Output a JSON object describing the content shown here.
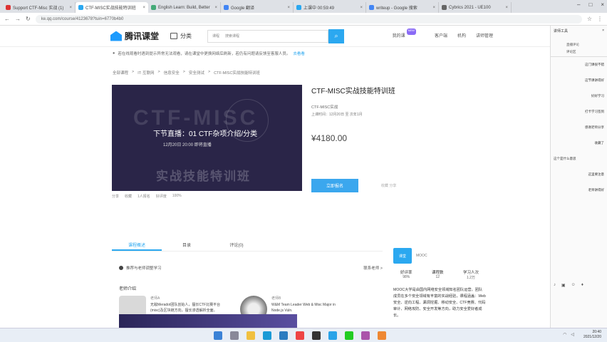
{
  "browser": {
    "tabs": [
      {
        "label": "Support CTF-Misc 实战 (1)",
        "color": "#d33"
      },
      {
        "label": "CTF-MISC实战技能特训班",
        "color": "#2ba8f0"
      },
      {
        "label": "English Learn: Build, Better",
        "color": "#4a7"
      },
      {
        "label": "Google 翻译",
        "color": "#4285f4"
      },
      {
        "label": "上课中 00:59:49",
        "color": "#2ba8f0"
      },
      {
        "label": "writeup - Google 搜索",
        "color": "#4285f4"
      },
      {
        "label": "Cybrics 2021 - UE100",
        "color": "#666"
      }
    ],
    "url": "ke.qq.com/course/4123678?tuin=6770b4b0",
    "window_controls": [
      "–",
      "□",
      "×"
    ]
  },
  "header": {
    "logo_text": "腾讯课堂",
    "category_label": "分类",
    "search_scope": "课程",
    "search_placeholder": "搜索课程",
    "search_icon": "search-icon",
    "right_links": [
      "我的课",
      "客户端",
      "机构",
      "讲师管理"
    ],
    "badge": "NEW"
  },
  "notice": {
    "text": "若在线观看时遇到提示异常无法观看，请在课堂中更换网络后刷新，若仍有问题请反馈至客服人员。",
    "link": "去看看"
  },
  "breadcrumb": [
    "全部课程",
    ">",
    "IT·互联网",
    ">",
    "信息安全",
    ">",
    "安全测试",
    ">",
    "CTF-MISC实战技能特训班"
  ],
  "video": {
    "title": "下节直播：01 CTF杂项介绍/分类",
    "date": "12月20日 20:00    即将直播",
    "bg_text": "CTF-MISC",
    "sub_text": "实战技能特训班"
  },
  "stats": [
    "分享",
    "收藏",
    "1人报名",
    "好评度",
    "100%"
  ],
  "course": {
    "title": "CTF-MISC实战技能特训班",
    "tag": "CTF-MISC实战",
    "schedule": "上课时间：12月20日 至 次年1月",
    "price": "¥4180.00",
    "buy_label": "立即报名",
    "fav_label": "收藏 分享"
  },
  "page_tabs": [
    "课程概述",
    "目录",
    "评论(0)"
  ],
  "teachers": {
    "recommend": "推荐与老师调整学习",
    "more": "联系老师 >",
    "intro_label": "老师介绍",
    "list": [
      {
        "name": "老师A",
        "desc": "无敌Meradot团队创始人，擅长CTF比赛平台(misc)及区块链方向，擅长渗透解析全面。"
      },
      {
        "name": "老师B",
        "desc": "W&M Team Leader Web & Misc Major in Node.js Vuln."
      }
    ]
  },
  "org": {
    "logo_text": "课堂",
    "name": "MOOC",
    "stats": [
      {
        "value": "好评率",
        "label": "98%"
      },
      {
        "value": "课程数",
        "label": "12"
      },
      {
        "value": "学习人次",
        "label": "1.2万"
      }
    ],
    "desc": "MOOC大学是由国内网络安全领域知名团队运营，团队成员在多个安全领域有丰富的实战经验，课程涵盖：Web安全、逆向工程、漏洞挖掘、移动安全、CTF竞赛、代码审计、网络攻防、安全开发等方向，助力安全爱好者成长。"
  },
  "side_panel": {
    "title": "讲师工具",
    "tab1": "直播评论",
    "tab2": "评论区",
    "messages": [
      "这门课很不错",
      "这节课讲得好",
      "好好学习",
      "打卡学习签到",
      "感谢老师分享",
      "收藏了",
      "这里要注意",
      "老师讲得好"
    ],
    "user_msg": "这个是什么意思"
  },
  "taskbar": {
    "time": "20:40",
    "date": "2021/12/20"
  }
}
